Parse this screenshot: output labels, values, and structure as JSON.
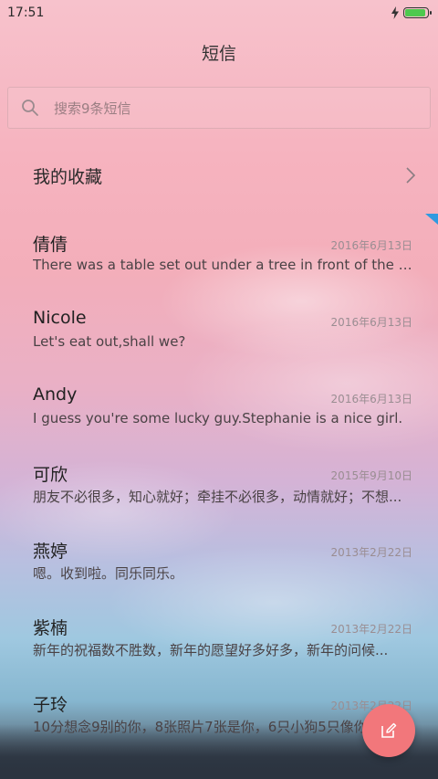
{
  "status_bar": {
    "time": "17:51",
    "battery_level": 0.9
  },
  "header": {
    "title": "短信"
  },
  "search": {
    "placeholder": "搜索9条短信"
  },
  "favorites": {
    "label": "我的收藏"
  },
  "conversations": [
    {
      "name": "倩倩",
      "date": "2016年6月13日",
      "preview": "There was a table set out under a tree in front of the ho.."
    },
    {
      "name": "Nicole",
      "date": "2016年6月13日",
      "preview": "Let's eat out,shall we?"
    },
    {
      "name": "Andy",
      "date": "2016年6月13日",
      "preview": "I guess you're some lucky guy.Stephanie is a nice girl."
    },
    {
      "name": "可欣",
      "date": "2015年9月10日",
      "preview": "朋友不必很多，知心就好；牵挂不必很多，动情就好；不想..."
    },
    {
      "name": "燕婷",
      "date": "2013年2月22日",
      "preview": "嗯。收到啦。同乐同乐。"
    },
    {
      "name": "紫楠",
      "date": "2013年2月22日",
      "preview": "新年的祝福数不胜数，新年的愿望好多好多，新年的问候..."
    },
    {
      "name": "子玲",
      "date": "2013年2月22日",
      "preview": "10分想念9别的你，8张照片7张是你，6只小狗5只像你..."
    }
  ],
  "icons": {
    "search": "search-icon",
    "chevron": "chevron-right-icon",
    "compose": "compose-icon",
    "charging": "charging-icon",
    "battery": "battery-icon"
  },
  "colors": {
    "fab": "#f2777b",
    "battery": "#4ec94e",
    "corner_mark": "#2f9ae0"
  }
}
